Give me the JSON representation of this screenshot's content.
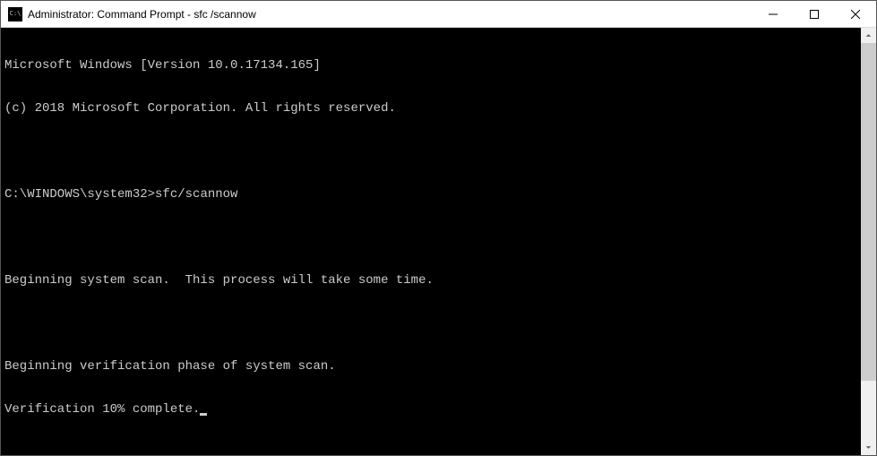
{
  "window": {
    "title": "Administrator: Command Prompt - sfc  /scannow"
  },
  "terminal": {
    "line_version": "Microsoft Windows [Version 10.0.17134.165]",
    "line_copyright": "(c) 2018 Microsoft Corporation. All rights reserved.",
    "prompt": "C:\\WINDOWS\\system32>",
    "command": "sfc/scannow",
    "line_begin_scan": "Beginning system scan.  This process will take some time.",
    "line_begin_verify": "Beginning verification phase of system scan.",
    "line_progress": "Verification 10% complete."
  }
}
